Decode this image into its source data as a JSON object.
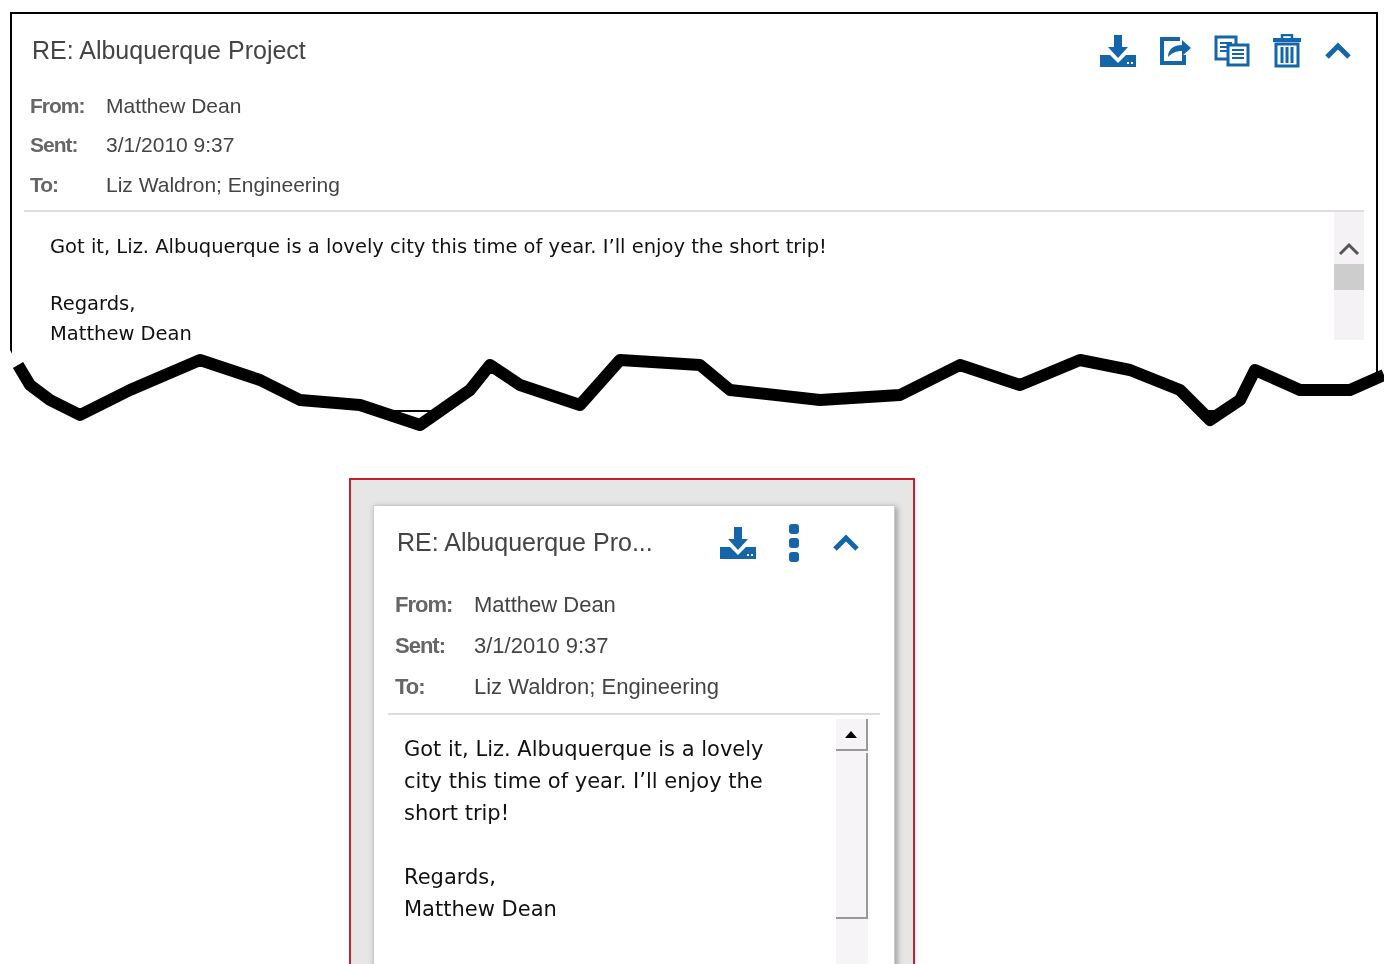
{
  "wide_view": {
    "subject": "RE: Albuquerque Project",
    "actions": [
      {
        "kind": "download"
      },
      {
        "kind": "forward"
      },
      {
        "kind": "copy"
      },
      {
        "kind": "delete"
      },
      {
        "kind": "collapse"
      }
    ],
    "headers": [
      {
        "label": "From:",
        "value": "Matthew Dean"
      },
      {
        "label": "Sent:",
        "value": "3/1/2010 9:37"
      },
      {
        "label": "To:",
        "value": "Liz Waldron; Engineering"
      }
    ],
    "body": [
      "Got it, Liz. Albuquerque is a lovely city this time of year. I’ll enjoy the short trip!",
      "Regards,\nMatthew Dean"
    ]
  },
  "narrow_view": {
    "subject": "RE: Albuquerque Pro...",
    "actions": [
      {
        "kind": "download"
      },
      {
        "kind": "more"
      },
      {
        "kind": "collapse"
      }
    ],
    "headers": [
      {
        "label": "From:",
        "value": "Matthew Dean"
      },
      {
        "label": "Sent:",
        "value": "3/1/2010 9:37"
      },
      {
        "label": "To:",
        "value": "Liz Waldron; Engineering"
      }
    ],
    "body": [
      "Got it, Liz. Albuquerque is a lovely city this time of year. I’ll enjoy the short trip!",
      "Regards,\nMatthew Dean"
    ]
  }
}
